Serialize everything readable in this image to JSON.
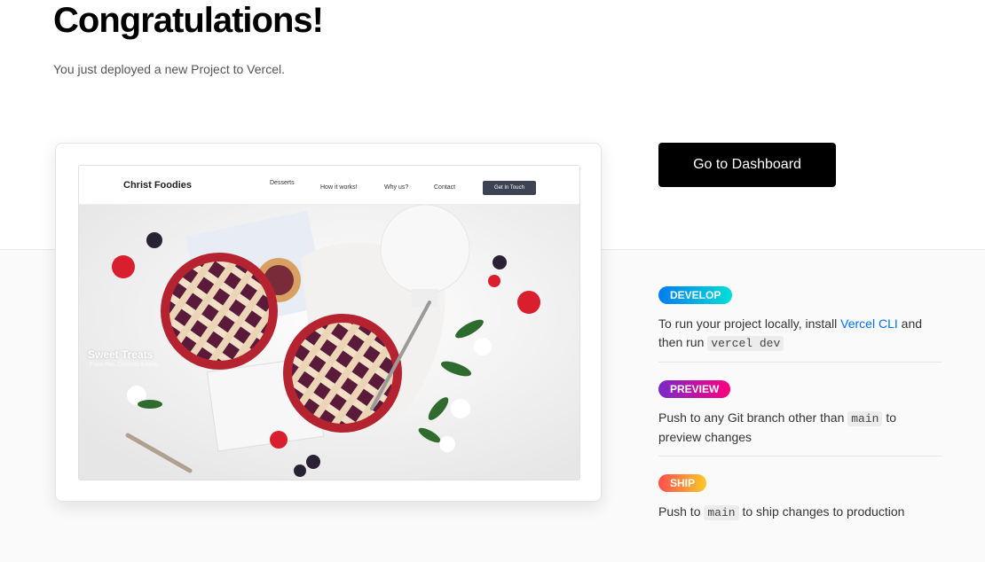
{
  "header": {
    "title": "Congratulations!",
    "subtitle": "You just deployed a new Project to Vercel."
  },
  "preview": {
    "site_logo": "Christ Foodies",
    "nav": [
      "Desserts",
      "How it works!",
      "Why us?",
      "Contact"
    ],
    "cta": "Get In Touch",
    "hero_title": "Sweet Treats",
    "hero_sub": "Fresh Pies, Desserts & More"
  },
  "actions": {
    "dashboard_label": "Go to Dashboard"
  },
  "steps": [
    {
      "badge": "DEVELOP",
      "text_before": "To run your project locally, install ",
      "link": "Vercel CLI",
      "text_middle": " and then run ",
      "code": "vercel dev",
      "text_after": ""
    },
    {
      "badge": "PREVIEW",
      "text_before": "Push to any Git branch other than ",
      "code": "main",
      "text_after": " to preview changes"
    },
    {
      "badge": "SHIP",
      "text_before": "Push to ",
      "code": "main",
      "text_after": " to ship changes to production"
    }
  ],
  "colors": {
    "develop_gradient": [
      "#007cf0",
      "#00dfd8"
    ],
    "preview_gradient": [
      "#7928ca",
      "#ff0080"
    ],
    "ship_gradient": [
      "#ff4d4d",
      "#f9cb28"
    ],
    "link": "#0070f3"
  }
}
